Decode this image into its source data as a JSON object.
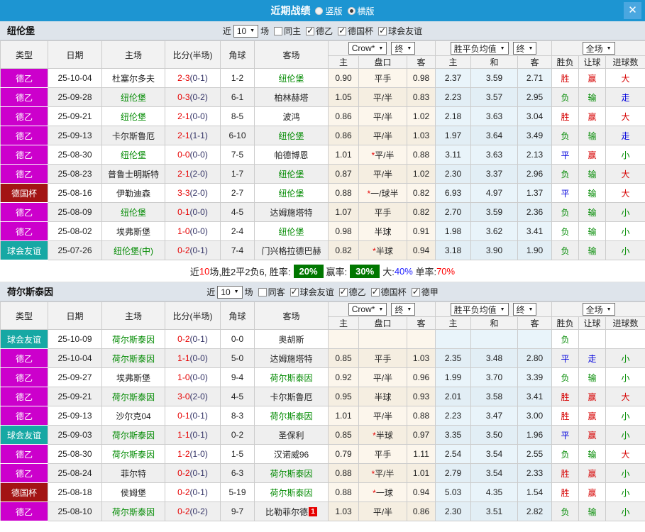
{
  "titlebar": {
    "title": "近期战绩",
    "radios": [
      {
        "label": "竖版",
        "checked": false
      },
      {
        "label": "横版",
        "checked": true
      }
    ],
    "close_label": "✕"
  },
  "colors": {
    "header_blue": "#1d95d2",
    "league_dey2": "#cc00cc",
    "german_cup": "#a31414",
    "club_friendly": "#16a8a4",
    "focus_team_green": "#008a00",
    "score_red": "#e60000",
    "summary_green_box": "#007700"
  },
  "type_colors": {
    "德乙": "#cc00cc",
    "德国杯": "#a31414",
    "球会友谊": "#16a8a4",
    "德甲": "#1d95d2"
  },
  "table_header": {
    "type": "类型",
    "date": "日期",
    "home": "主场",
    "score": "比分(半场)",
    "corner": "角球",
    "away": "客场",
    "crown_select": "Crow*",
    "final_select": "终",
    "avg_select": "胜平负均值",
    "scope_select": "全场",
    "home_odds": "主",
    "handicap": "盘口",
    "away_odds": "客",
    "home_avg": "主",
    "draw_avg": "和",
    "away_avg": "客",
    "result": "胜负",
    "handicap_result": "让球",
    "goals": "进球数"
  },
  "sections": [
    {
      "team": "纽伦堡",
      "filters": {
        "near": "近",
        "count": "10",
        "games": "场",
        "checkboxes": [
          {
            "label": "同主",
            "checked": false
          },
          {
            "label": "德乙",
            "checked": true
          },
          {
            "label": "德国杯",
            "checked": true
          },
          {
            "label": "球会友谊",
            "checked": true
          }
        ]
      },
      "rows": [
        {
          "type": "德乙",
          "date": "25-10-04",
          "home": "杜塞尔多夫",
          "home_focus": false,
          "ft": "2-3",
          "ht": "(0-1)",
          "corner": "1-2",
          "away": "纽伦堡",
          "away_focus": true,
          "o1": "0.90",
          "pan": "平手",
          "o2": "0.98",
          "m1": "2.37",
          "m2": "3.59",
          "m3": "2.71",
          "res": "胜",
          "let": "赢",
          "goal": "大"
        },
        {
          "type": "德乙",
          "date": "25-09-28",
          "home": "纽伦堡",
          "home_focus": true,
          "ft": "0-3",
          "ht": "(0-2)",
          "corner": "6-1",
          "away": "柏林赫塔",
          "away_focus": false,
          "o1": "1.05",
          "pan": "平/半",
          "o2": "0.83",
          "m1": "2.23",
          "m2": "3.57",
          "m3": "2.95",
          "res": "负",
          "let": "输",
          "goal": "走"
        },
        {
          "type": "德乙",
          "date": "25-09-21",
          "home": "纽伦堡",
          "home_focus": true,
          "ft": "2-1",
          "ht": "(0-0)",
          "corner": "8-5",
          "away": "波鸿",
          "away_focus": false,
          "o1": "0.86",
          "pan": "平/半",
          "o2": "1.02",
          "m1": "2.18",
          "m2": "3.63",
          "m3": "3.04",
          "res": "胜",
          "let": "赢",
          "goal": "大"
        },
        {
          "type": "德乙",
          "date": "25-09-13",
          "home": "卡尔斯鲁厄",
          "home_focus": false,
          "ft": "2-1",
          "ht": "(1-1)",
          "corner": "6-10",
          "away": "纽伦堡",
          "away_focus": true,
          "o1": "0.86",
          "pan": "平/半",
          "o2": "1.03",
          "m1": "1.97",
          "m2": "3.64",
          "m3": "3.49",
          "res": "负",
          "let": "输",
          "goal": "走"
        },
        {
          "type": "德乙",
          "date": "25-08-30",
          "home": "纽伦堡",
          "home_focus": true,
          "ft": "0-0",
          "ht": "(0-0)",
          "corner": "7-5",
          "away": "帕德博恩",
          "away_focus": false,
          "o1": "1.01",
          "pan": "*平/半",
          "o2": "0.88",
          "m1": "3.11",
          "m2": "3.63",
          "m3": "2.13",
          "res": "平",
          "let": "赢",
          "goal": "小"
        },
        {
          "type": "德乙",
          "date": "25-08-23",
          "home": "普鲁士明斯特",
          "home_focus": false,
          "ft": "2-1",
          "ht": "(2-0)",
          "corner": "1-7",
          "away": "纽伦堡",
          "away_focus": true,
          "o1": "0.87",
          "pan": "平/半",
          "o2": "1.02",
          "m1": "2.30",
          "m2": "3.37",
          "m3": "2.96",
          "res": "负",
          "let": "输",
          "goal": "大"
        },
        {
          "type": "德国杯",
          "date": "25-08-16",
          "home": "伊勒迪森",
          "home_focus": false,
          "ft": "3-3",
          "ht": "(2-0)",
          "corner": "2-7",
          "away": "纽伦堡",
          "away_focus": true,
          "o1": "0.88",
          "pan": "*一/球半",
          "o2": "0.82",
          "m1": "6.93",
          "m2": "4.97",
          "m3": "1.37",
          "res": "平",
          "let": "输",
          "goal": "大"
        },
        {
          "type": "德乙",
          "date": "25-08-09",
          "home": "纽伦堡",
          "home_focus": true,
          "ft": "0-1",
          "ht": "(0-0)",
          "corner": "4-5",
          "away": "达姆施塔特",
          "away_focus": false,
          "o1": "1.07",
          "pan": "平手",
          "o2": "0.82",
          "m1": "2.70",
          "m2": "3.59",
          "m3": "2.36",
          "res": "负",
          "let": "输",
          "goal": "小"
        },
        {
          "type": "德乙",
          "date": "25-08-02",
          "home": "埃弗斯堡",
          "home_focus": false,
          "ft": "1-0",
          "ht": "(0-0)",
          "corner": "2-4",
          "away": "纽伦堡",
          "away_focus": true,
          "o1": "0.98",
          "pan": "半球",
          "o2": "0.91",
          "m1": "1.98",
          "m2": "3.62",
          "m3": "3.41",
          "res": "负",
          "let": "输",
          "goal": "小"
        },
        {
          "type": "球会友谊",
          "date": "25-07-26",
          "home": "纽伦堡(中)",
          "home_focus": true,
          "ft": "0-2",
          "ht": "(0-1)",
          "corner": "7-4",
          "away": "门兴格拉德巴赫",
          "away_focus": false,
          "o1": "0.82",
          "pan": "*半球",
          "o2": "0.94",
          "m1": "3.18",
          "m2": "3.90",
          "m3": "1.90",
          "res": "负",
          "let": "输",
          "goal": "小"
        }
      ],
      "summary": [
        {
          "t": "近"
        },
        {
          "t": "10",
          "c": "red"
        },
        {
          "t": "场,胜2平2负6, 胜率:"
        },
        {
          "t": "20%",
          "c": "greenbox"
        },
        {
          "t": "赢率:"
        },
        {
          "t": "30%",
          "c": "greenbox"
        },
        {
          "t": "大:"
        },
        {
          "t": "40%",
          "c": "blue"
        },
        {
          "t": " 单率:"
        },
        {
          "t": "70%",
          "c": "red"
        }
      ]
    },
    {
      "team": "荷尔斯泰因",
      "filters": {
        "near": "近",
        "count": "10",
        "games": "场",
        "checkboxes": [
          {
            "label": "同客",
            "checked": false
          },
          {
            "label": "球会友谊",
            "checked": true
          },
          {
            "label": "德乙",
            "checked": true
          },
          {
            "label": "德国杯",
            "checked": true
          },
          {
            "label": "德甲",
            "checked": true
          }
        ]
      },
      "rows": [
        {
          "type": "球会友谊",
          "date": "25-10-09",
          "home": "荷尔斯泰因",
          "home_focus": true,
          "ft": "0-2",
          "ht": "(0-1)",
          "corner": "0-0",
          "away": "奥胡斯",
          "away_focus": false,
          "o1": "",
          "pan": "",
          "o2": "",
          "m1": "",
          "m2": "",
          "m3": "",
          "res": "负",
          "let": "",
          "goal": ""
        },
        {
          "type": "德乙",
          "date": "25-10-04",
          "home": "荷尔斯泰因",
          "home_focus": true,
          "ft": "1-1",
          "ht": "(0-0)",
          "corner": "5-0",
          "away": "达姆施塔特",
          "away_focus": false,
          "o1": "0.85",
          "pan": "平手",
          "o2": "1.03",
          "m1": "2.35",
          "m2": "3.48",
          "m3": "2.80",
          "res": "平",
          "let": "走",
          "goal": "小"
        },
        {
          "type": "德乙",
          "date": "25-09-27",
          "home": "埃弗斯堡",
          "home_focus": false,
          "ft": "1-0",
          "ht": "(0-0)",
          "corner": "9-4",
          "away": "荷尔斯泰因",
          "away_focus": true,
          "o1": "0.92",
          "pan": "平/半",
          "o2": "0.96",
          "m1": "1.99",
          "m2": "3.70",
          "m3": "3.39",
          "res": "负",
          "let": "输",
          "goal": "小"
        },
        {
          "type": "德乙",
          "date": "25-09-21",
          "home": "荷尔斯泰因",
          "home_focus": true,
          "ft": "3-0",
          "ht": "(2-0)",
          "corner": "4-5",
          "away": "卡尔斯鲁厄",
          "away_focus": false,
          "o1": "0.95",
          "pan": "半球",
          "o2": "0.93",
          "m1": "2.01",
          "m2": "3.58",
          "m3": "3.41",
          "res": "胜",
          "let": "赢",
          "goal": "大"
        },
        {
          "type": "德乙",
          "date": "25-09-13",
          "home": "沙尔克04",
          "home_focus": false,
          "ft": "0-1",
          "ht": "(0-1)",
          "corner": "8-3",
          "away": "荷尔斯泰因",
          "away_focus": true,
          "o1": "1.01",
          "pan": "平/半",
          "o2": "0.88",
          "m1": "2.23",
          "m2": "3.47",
          "m3": "3.00",
          "res": "胜",
          "let": "赢",
          "goal": "小"
        },
        {
          "type": "球会友谊",
          "date": "25-09-03",
          "home": "荷尔斯泰因",
          "home_focus": true,
          "ft": "1-1",
          "ht": "(0-1)",
          "corner": "0-2",
          "away": "圣保利",
          "away_focus": false,
          "o1": "0.85",
          "pan": "*半球",
          "o2": "0.97",
          "m1": "3.35",
          "m2": "3.50",
          "m3": "1.96",
          "res": "平",
          "let": "赢",
          "goal": "小"
        },
        {
          "type": "德乙",
          "date": "25-08-30",
          "home": "荷尔斯泰因",
          "home_focus": true,
          "ft": "1-2",
          "ht": "(1-0)",
          "corner": "1-5",
          "away": "汉诺威96",
          "away_focus": false,
          "o1": "0.79",
          "pan": "平手",
          "o2": "1.11",
          "m1": "2.54",
          "m2": "3.54",
          "m3": "2.55",
          "res": "负",
          "let": "输",
          "goal": "大"
        },
        {
          "type": "德乙",
          "date": "25-08-24",
          "home": "菲尔特",
          "home_focus": false,
          "ft": "0-2",
          "ht": "(0-1)",
          "corner": "6-3",
          "away": "荷尔斯泰因",
          "away_focus": true,
          "o1": "0.88",
          "pan": "*平/半",
          "o2": "1.01",
          "m1": "2.79",
          "m2": "3.54",
          "m3": "2.33",
          "res": "胜",
          "let": "赢",
          "goal": "小"
        },
        {
          "type": "德国杯",
          "date": "25-08-18",
          "home": "侯姆堡",
          "home_focus": false,
          "ft": "0-2",
          "ht": "(0-1)",
          "corner": "5-19",
          "away": "荷尔斯泰因",
          "away_focus": true,
          "o1": "0.88",
          "pan": "*一球",
          "o2": "0.94",
          "m1": "5.03",
          "m2": "4.35",
          "m3": "1.54",
          "res": "胜",
          "let": "赢",
          "goal": "小"
        },
        {
          "type": "德乙",
          "date": "25-08-10",
          "home": "荷尔斯泰因",
          "home_focus": true,
          "ft": "0-2",
          "ht": "(0-2)",
          "corner": "9-7",
          "away": "比勒菲尔德",
          "away_focus": false,
          "away_badge": "1",
          "o1": "1.03",
          "pan": "平/半",
          "o2": "0.86",
          "m1": "2.30",
          "m2": "3.51",
          "m3": "2.82",
          "res": "负",
          "let": "输",
          "goal": "小"
        }
      ]
    }
  ]
}
